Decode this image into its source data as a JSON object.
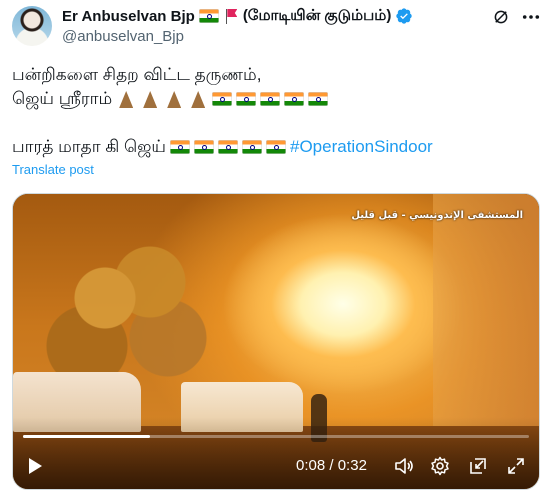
{
  "author": {
    "name": "Er Anbuselvan Bjp",
    "family_tag": "(மோடியின் குடும்பம்)",
    "handle": "@anbuselvan_Bjp",
    "verified_color": "#1d9bf0"
  },
  "tweet": {
    "line1": "பன்றிகளை சிதற விட்ட தருணம்,",
    "line2_text": "ஜெய் ஸ்ரீராம்",
    "line3_text": "பாரத் மாதா கி ஜெய்",
    "hashtag": "#OperationSindoor",
    "translate_label": "Translate post"
  },
  "video": {
    "watermark": "المستشفى الإندونيسي - قبل قليل",
    "current_time": "0:08",
    "separator": " / ",
    "duration": "0:32",
    "progress_fraction": 0.25
  },
  "icons": {
    "grok": "grok-icon",
    "more": "more-icon",
    "play": "play-icon",
    "volume": "volume-icon",
    "settings": "gear-icon",
    "pip": "picture-in-picture-icon",
    "fullscreen": "fullscreen-icon"
  },
  "colors": {
    "link": "#1d9bf0",
    "text": "#0f1419",
    "secondary": "#536471"
  }
}
